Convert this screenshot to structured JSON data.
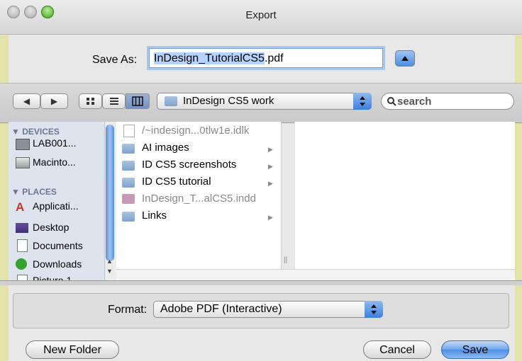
{
  "window": {
    "title": "Export"
  },
  "save_as": {
    "label": "Save As:",
    "filename_base": "InDesign_TutorialCS5",
    "filename_ext": ".pdf"
  },
  "toolbar": {
    "back_icon": "◀",
    "forward_icon": "▶",
    "view_icons": [
      "icon-view-icon",
      "list-view-icon",
      "column-view-icon"
    ],
    "location": "InDesign CS5 work",
    "search_placeholder": "search"
  },
  "sidebar": {
    "devices_header": "▼ DEVICES",
    "devices": [
      "LAB001...",
      "Macinto..."
    ],
    "places_header": "▼ PLACES",
    "places": [
      "Applicati...",
      "Desktop",
      "Documents",
      "Downloads",
      "Picture 1"
    ]
  },
  "files": [
    {
      "name": "/~indesign...0tlw1e.idlk",
      "kind": "doc",
      "dimmed": true,
      "folder": false
    },
    {
      "name": "AI images",
      "kind": "folder",
      "dimmed": false,
      "folder": true
    },
    {
      "name": "ID CS5 screenshots",
      "kind": "folder",
      "dimmed": false,
      "folder": true
    },
    {
      "name": "ID CS5 tutorial",
      "kind": "folder",
      "dimmed": false,
      "folder": true
    },
    {
      "name": "InDesign_T...alCS5.indd",
      "kind": "indd",
      "dimmed": true,
      "folder": false
    },
    {
      "name": "Links",
      "kind": "folder",
      "dimmed": false,
      "folder": true
    }
  ],
  "format": {
    "label": "Format:",
    "value": "Adobe PDF (Interactive)"
  },
  "buttons": {
    "new_folder": "New Folder",
    "cancel": "Cancel",
    "save": "Save"
  }
}
